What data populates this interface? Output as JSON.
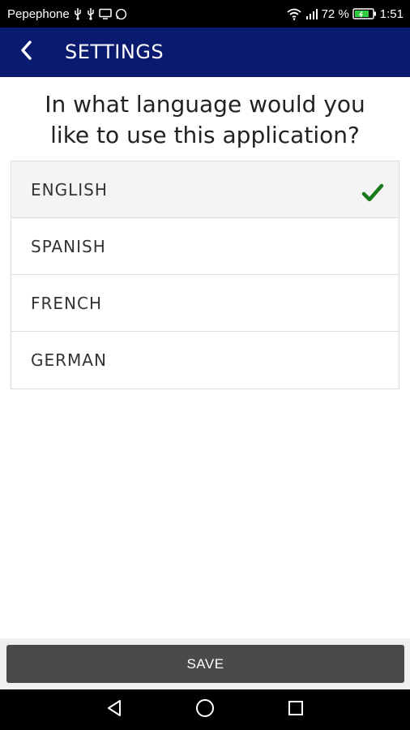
{
  "status_bar": {
    "carrier": "Pepephone",
    "battery": "72 %",
    "time": "1:51",
    "icons_left": [
      "usb-icon",
      "usb-icon",
      "screen-icon",
      "whatsapp-icon"
    ],
    "icons_right": [
      "wifi-icon",
      "signal-icon",
      "battery-icon"
    ]
  },
  "app_bar": {
    "title": "SETTINGS",
    "back_icon": "chevron-left-icon",
    "background": "#0a1a6e"
  },
  "question": {
    "line1": "In what language would you",
    "line2": "like to use this application?"
  },
  "languages": [
    {
      "label": "ENGLISH",
      "selected": true
    },
    {
      "label": "SPANISH",
      "selected": false
    },
    {
      "label": "FRENCH",
      "selected": false
    },
    {
      "label": "GERMAN",
      "selected": false
    }
  ],
  "check_color": "#1a7a1a",
  "save": {
    "label": "SAVE",
    "background": "#4a4a4a"
  },
  "nav": {
    "icons": [
      "back-triangle-icon",
      "home-circle-icon",
      "recents-square-icon"
    ]
  }
}
